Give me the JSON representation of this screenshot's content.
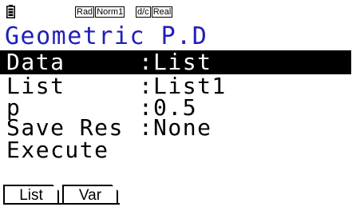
{
  "status_bar": {
    "battery_icon": "battery-icon",
    "angle_mode": "Rad",
    "display_mode": "Norm1",
    "fraction_mode": "d/c",
    "complex_mode": "Real"
  },
  "title": "Geometric P.D",
  "rows": [
    {
      "label": "Data",
      "value": "List",
      "selected": true
    },
    {
      "label": "List",
      "value": "List1",
      "selected": false
    },
    {
      "label": "p",
      "value": "0.5",
      "selected": false
    },
    {
      "label": "Save Res",
      "value": "None",
      "selected": false
    },
    {
      "label": "Execute",
      "value": "",
      "selected": false
    }
  ],
  "colon": ":",
  "function_keys": [
    "List",
    "Var"
  ],
  "colors": {
    "title": "#1f1fb8",
    "selection": "#000000",
    "background": "#ffffff"
  }
}
